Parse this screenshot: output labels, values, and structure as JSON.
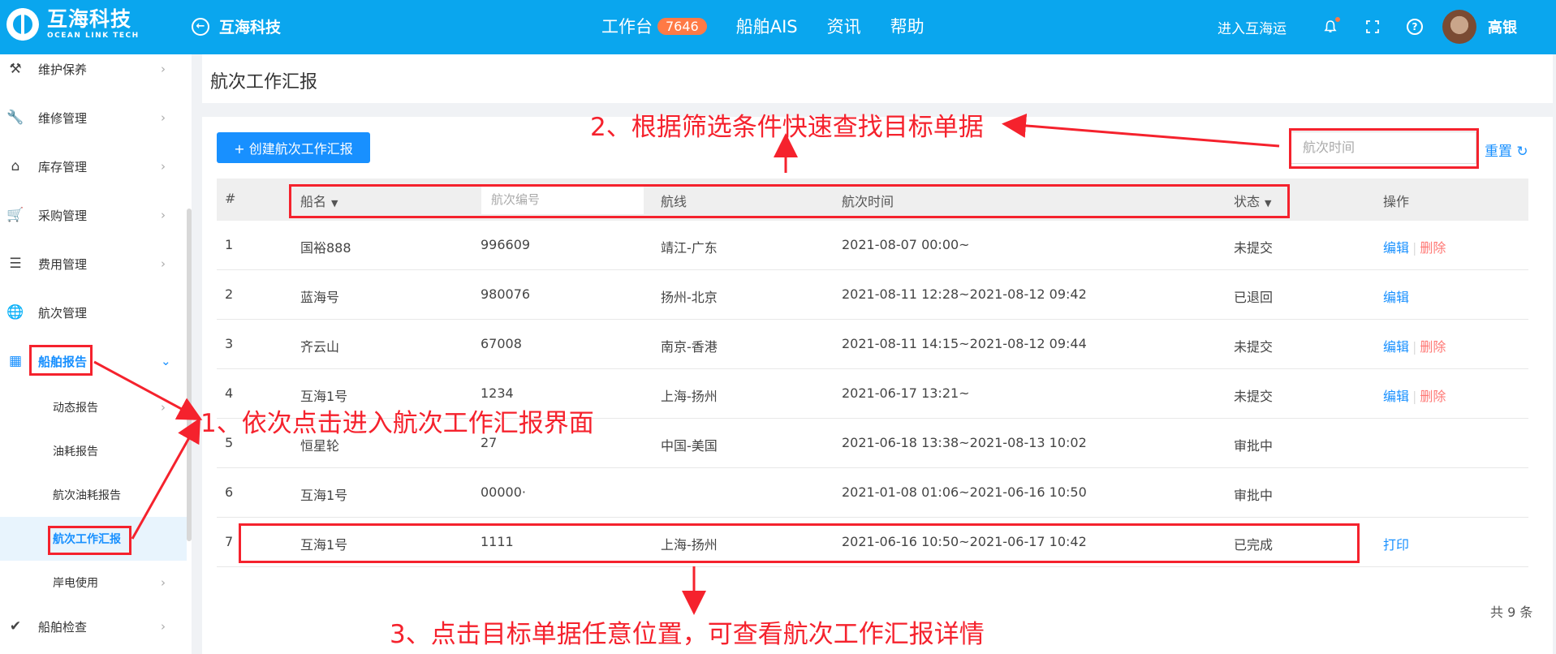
{
  "header": {
    "brand_cn": "互海科技",
    "brand_en": "OCEAN LINK TECH",
    "org": "互海科技",
    "nav": [
      {
        "label": "工作台",
        "badge": "7646"
      },
      {
        "label": "船舶AIS"
      },
      {
        "label": "资讯"
      },
      {
        "label": "帮助"
      }
    ],
    "enter_link": "进入互海运",
    "user": "高银",
    "icons": [
      "back-icon",
      "bell-icon",
      "fullscreen-icon",
      "help-icon"
    ]
  },
  "sidebar": {
    "items": [
      {
        "label": "维护保养",
        "icon": "hammer-icon"
      },
      {
        "label": "维修管理",
        "icon": "wrench-icon"
      },
      {
        "label": "库存管理",
        "icon": "warehouse-icon"
      },
      {
        "label": "采购管理",
        "icon": "cart-icon"
      },
      {
        "label": "费用管理",
        "icon": "coins-icon"
      },
      {
        "label": "航次管理",
        "icon": "globe-icon"
      },
      {
        "label": "船舶报告",
        "icon": "calendar-icon"
      },
      {
        "label": "动态报告"
      },
      {
        "label": "油耗报告"
      },
      {
        "label": "航次油耗报告"
      },
      {
        "label": "航次工作汇报"
      },
      {
        "label": "岸电使用"
      },
      {
        "label": "船舶检查",
        "icon": "check-circle-icon"
      }
    ]
  },
  "page": {
    "title": "航次工作汇报",
    "create_button": "+ 创建航次工作汇报",
    "filter_placeholder": "航次时间",
    "reset": "重置",
    "total": "共 9 条"
  },
  "table": {
    "columns": [
      "#",
      "船名",
      "航次编号",
      "航线",
      "航次时间",
      "状态",
      "操作"
    ],
    "rows": [
      {
        "no": "1",
        "ship": "国裕888",
        "voyage": "996609",
        "route": "靖江-广东",
        "time": "2021-08-07 00:00~",
        "status": "未提交",
        "edit": "编辑",
        "delete": "删除"
      },
      {
        "no": "2",
        "ship": "蓝海号",
        "voyage": "980076",
        "route": "扬州-北京",
        "time": "2021-08-11 12:28~2021-08-12 09:42",
        "status": "已退回",
        "edit": "编辑"
      },
      {
        "no": "3",
        "ship": "齐云山",
        "voyage": "67008",
        "route": "南京-香港",
        "time": "2021-08-11 14:15~2021-08-12 09:44",
        "status": "未提交",
        "edit": "编辑",
        "delete": "删除"
      },
      {
        "no": "4",
        "ship": "互海1号",
        "voyage": "1234",
        "route": "上海-扬州",
        "time": "2021-06-17 13:21~",
        "status": "未提交",
        "edit": "编辑",
        "delete": "删除"
      },
      {
        "no": "5",
        "ship": "恒星轮",
        "voyage": "27",
        "route": "中国-美国",
        "time": "2021-06-18 13:38~2021-08-13 10:02",
        "status": "审批中"
      },
      {
        "no": "6",
        "ship": "互海1号",
        "voyage": "00000·",
        "route": "",
        "time": "2021-01-08 01:06~2021-06-16 10:50",
        "status": "审批中"
      },
      {
        "no": "7",
        "ship": "互海1号",
        "voyage": "1111",
        "route": "上海-扬州",
        "time": "2021-06-16 10:50~2021-06-17 10:42",
        "status": "已完成",
        "print": "打印"
      }
    ]
  },
  "annotations": {
    "step1": "1、依次点击进入航次工作汇报界面",
    "step2": "2、根据筛选条件快速查找目标单据",
    "step3": "3、点击目标单据任意位置，可查看航次工作汇报详情",
    "color": "#f5222d"
  },
  "colors": {
    "topbar": "#0aa6ee",
    "primary": "#1890ff",
    "danger": "#ff7875",
    "badge": "#ff7a45"
  }
}
